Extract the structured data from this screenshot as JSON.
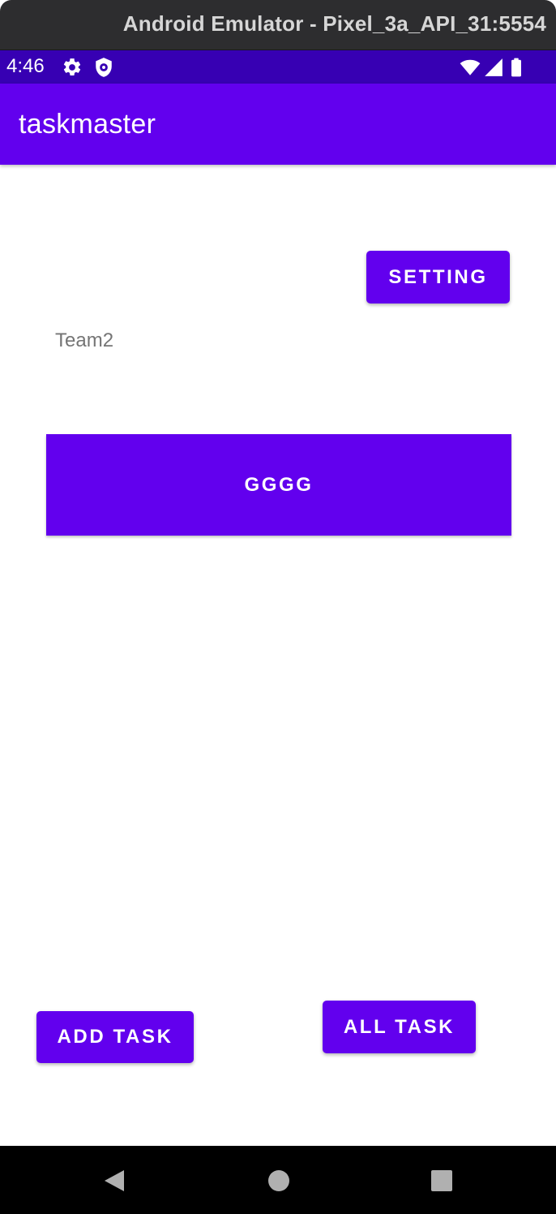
{
  "window": {
    "title": "Android Emulator - Pixel_3a_API_31:5554"
  },
  "status_bar": {
    "time": "4:46",
    "left_icons": [
      "gear-icon",
      "shield-icon"
    ],
    "right_icons": [
      "wifi-icon",
      "signal-icon",
      "battery-icon"
    ]
  },
  "app_bar": {
    "title": "taskmaster"
  },
  "main": {
    "setting_button": "SETTING",
    "team_label": "Team2",
    "tasks": [
      {
        "title": "GGGG"
      }
    ],
    "add_task_button": "ADD TASK",
    "all_task_button": "ALL TASK"
  },
  "nav_bar": {
    "buttons": [
      "back-icon",
      "home-icon",
      "recents-icon"
    ]
  },
  "colors": {
    "primary": "#6200ee",
    "primary_dark": "#3700b3",
    "secondary_text": "#757575"
  }
}
